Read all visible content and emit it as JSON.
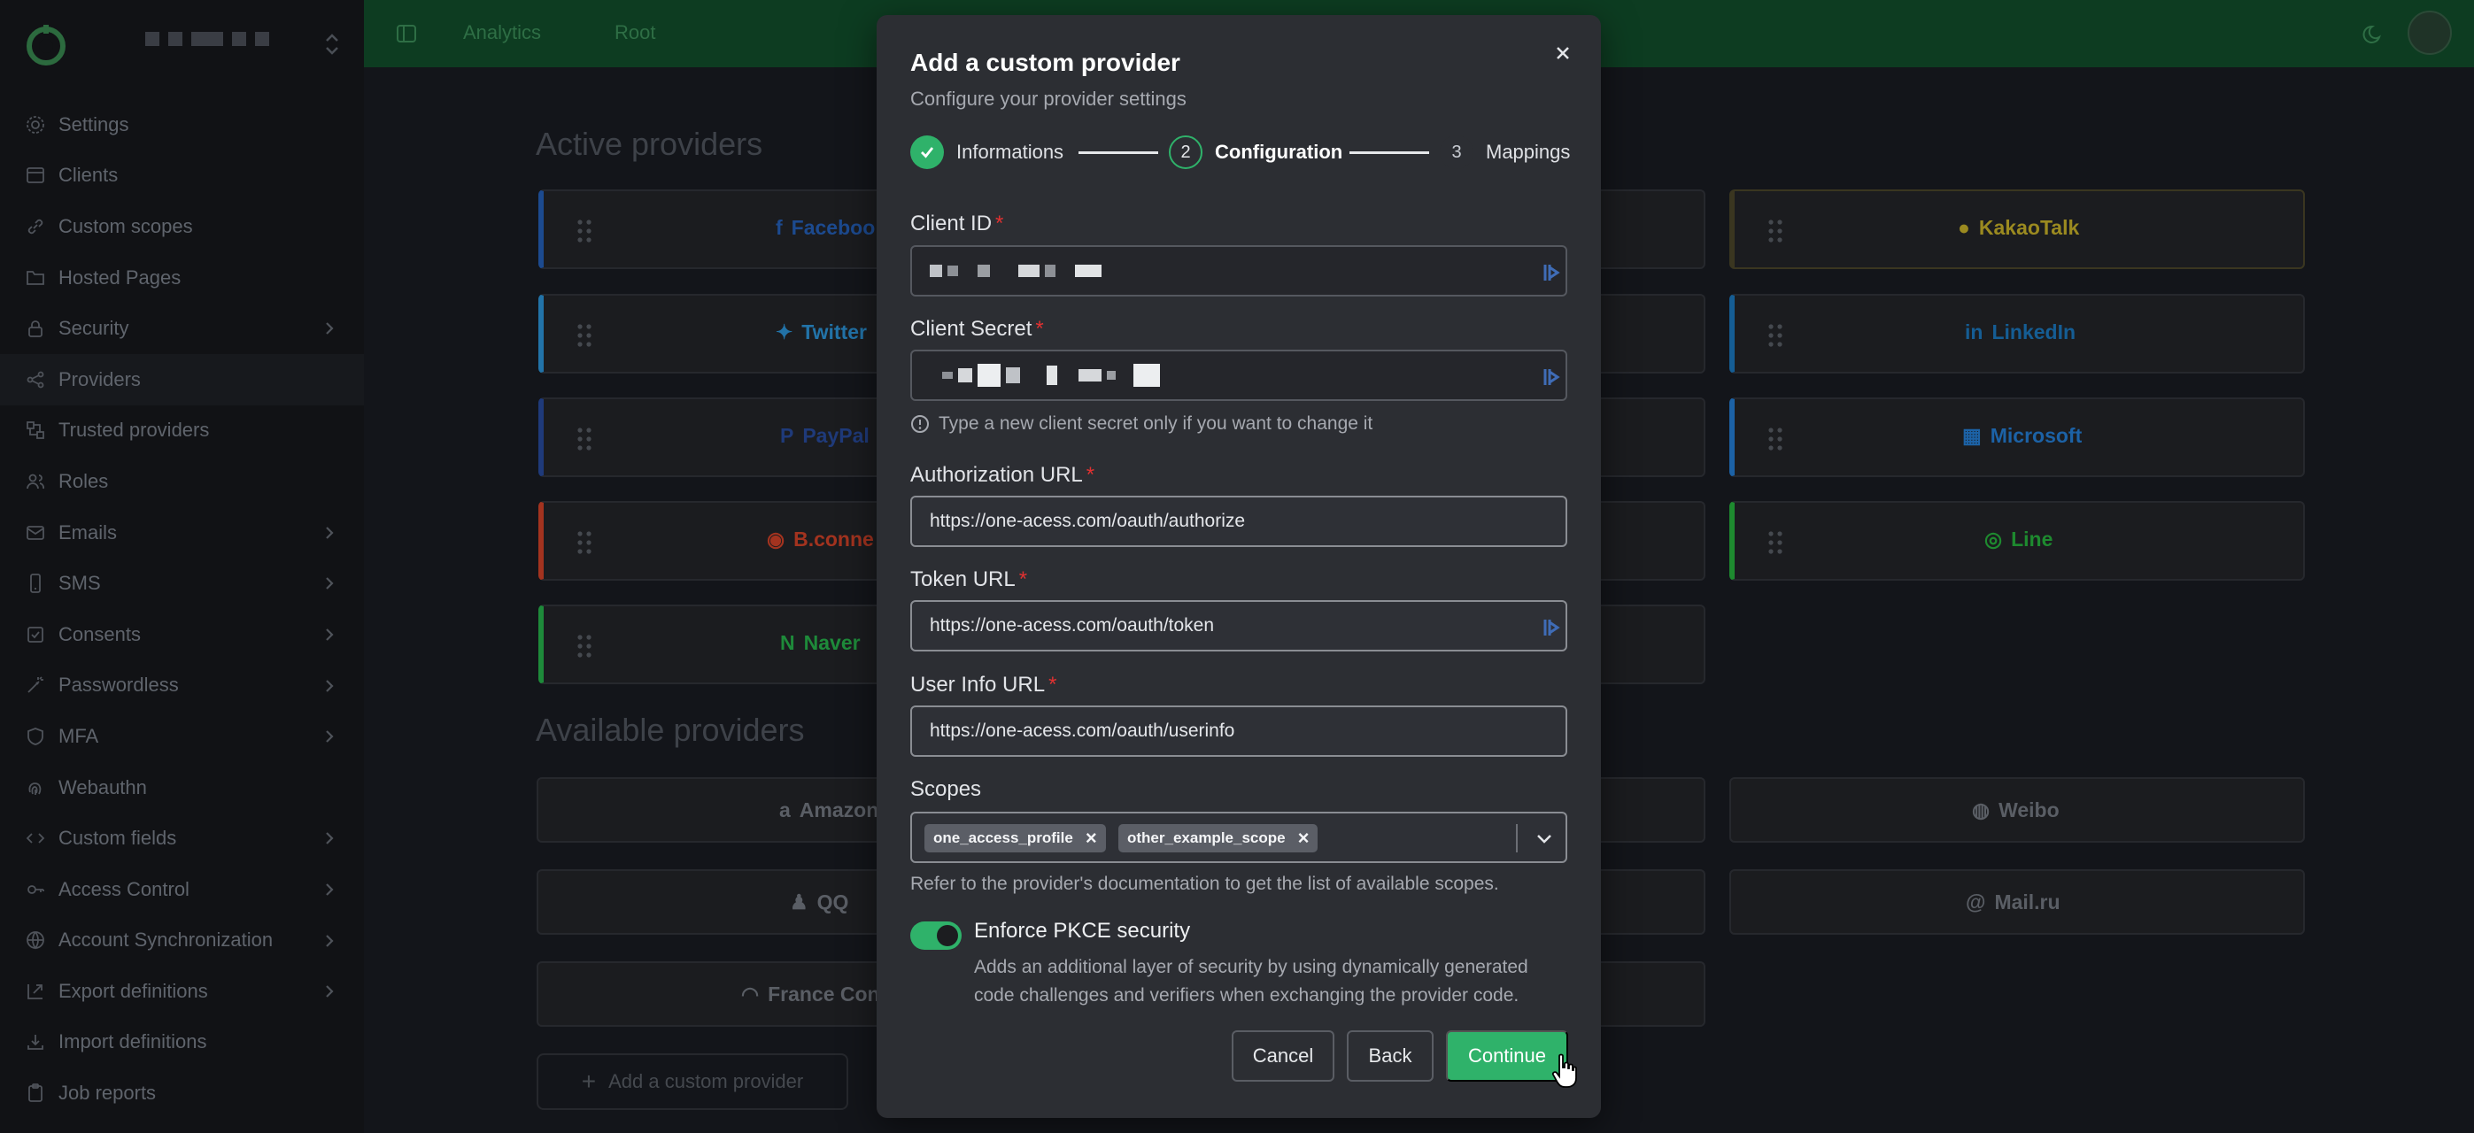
{
  "sidebar": {
    "org_chevron": "chevron-updown-icon",
    "items": [
      {
        "label": "Settings",
        "icon": "gear-icon",
        "chevron": false
      },
      {
        "label": "Clients",
        "icon": "window-icon",
        "chevron": false
      },
      {
        "label": "Custom scopes",
        "icon": "link-icon",
        "chevron": false
      },
      {
        "label": "Hosted Pages",
        "icon": "folder-icon",
        "chevron": false
      },
      {
        "label": "Security",
        "icon": "lock-icon",
        "chevron": true
      },
      {
        "label": "Providers",
        "icon": "share-icon",
        "chevron": false,
        "active": true
      },
      {
        "label": "Trusted providers",
        "icon": "network-icon",
        "chevron": false
      },
      {
        "label": "Roles",
        "icon": "users-icon",
        "chevron": false
      },
      {
        "label": "Emails",
        "icon": "mail-icon",
        "chevron": true
      },
      {
        "label": "SMS",
        "icon": "phone-icon",
        "chevron": true
      },
      {
        "label": "Consents",
        "icon": "checkbox-icon",
        "chevron": true
      },
      {
        "label": "Passwordless",
        "icon": "wand-icon",
        "chevron": true
      },
      {
        "label": "MFA",
        "icon": "shield-icon",
        "chevron": true
      },
      {
        "label": "Webauthn",
        "icon": "fingerprint-icon",
        "chevron": false
      },
      {
        "label": "Custom fields",
        "icon": "code-icon",
        "chevron": true
      },
      {
        "label": "Access Control",
        "icon": "key-icon",
        "chevron": true
      },
      {
        "label": "Account Synchronization",
        "icon": "globe-icon",
        "chevron": true
      },
      {
        "label": "Export definitions",
        "icon": "export-icon",
        "chevron": true
      },
      {
        "label": "Import definitions",
        "icon": "import-icon",
        "chevron": false
      },
      {
        "label": "Job reports",
        "icon": "clipboard-icon",
        "chevron": false
      }
    ]
  },
  "topbar": {
    "crumbs": [
      "Analytics",
      "Root"
    ]
  },
  "main": {
    "active_title": "Active providers",
    "available_title": "Available providers",
    "active_providers": [
      {
        "label": "Faceboo",
        "icon": "facebook-icon",
        "color": "#1c4a8f"
      },
      {
        "label": "KakaoTalk",
        "icon": "chat-bubble-icon",
        "color": "#9b8a20"
      },
      {
        "label": "Twitter",
        "icon": "twitter-icon",
        "color": "#2273a8"
      },
      {
        "label": "LinkedIn",
        "icon": "linkedin-icon",
        "color": "#155d94"
      },
      {
        "label": "PayPal",
        "icon": "paypal-icon",
        "color": "#1f3a7a"
      },
      {
        "label": "Microsoft",
        "icon": "windows-icon",
        "color": "#1c62a6"
      },
      {
        "label": "B.conne",
        "icon": "bconnect-icon",
        "color": "#a3331f"
      },
      {
        "label": "Line",
        "icon": "line-icon",
        "color": "#1e8a2f"
      },
      {
        "label": "Naver",
        "icon": "naver-icon",
        "color": "#1e8a3a"
      }
    ],
    "available_providers": [
      {
        "label": "Amazon",
        "icon": "amazon-icon"
      },
      {
        "label": "Weibo",
        "icon": "weibo-icon"
      },
      {
        "label": "QQ",
        "icon": "qq-icon"
      },
      {
        "label": "Mail.ru",
        "icon": "at-icon"
      },
      {
        "label": "France Conn",
        "icon": "franceconnect-icon"
      }
    ],
    "add_custom_label": "Add a custom provider"
  },
  "modal": {
    "title": "Add a custom provider",
    "subtitle": "Configure your provider settings",
    "steps": [
      {
        "number": "1",
        "label": "Informations",
        "state": "done"
      },
      {
        "number": "2",
        "label": "Configuration",
        "state": "current"
      },
      {
        "number": "3",
        "label": "Mappings",
        "state": "upcoming"
      }
    ],
    "fields": {
      "client_id": {
        "label": "Client ID",
        "required": "*"
      },
      "client_secret": {
        "label": "Client Secret",
        "required": "*",
        "help": "Type a new client secret only if you want to change it"
      },
      "authorization_url": {
        "label": "Authorization URL",
        "required": "*",
        "value": "https://one-acess.com/oauth/authorize"
      },
      "token_url": {
        "label": "Token URL",
        "required": "*",
        "value": "https://one-acess.com/oauth/token"
      },
      "userinfo_url": {
        "label": "User Info URL",
        "required": "*",
        "value": "https://one-acess.com/oauth/userinfo"
      },
      "scopes": {
        "label": "Scopes",
        "values": [
          "one_access_profile",
          "other_example_scope"
        ],
        "help": "Refer to the provider's documentation to get the list of available scopes."
      }
    },
    "pkce": {
      "enabled": true,
      "label": "Enforce PKCE security",
      "description": "Adds an additional layer of security by using dynamically generated code challenges and verifiers when exchanging the provider code."
    },
    "buttons": {
      "cancel": "Cancel",
      "back": "Back",
      "continue": "Continue"
    }
  },
  "colors": {
    "accent": "#2fb26a",
    "topbar": "#0d3c21",
    "danger": "#e03131"
  }
}
